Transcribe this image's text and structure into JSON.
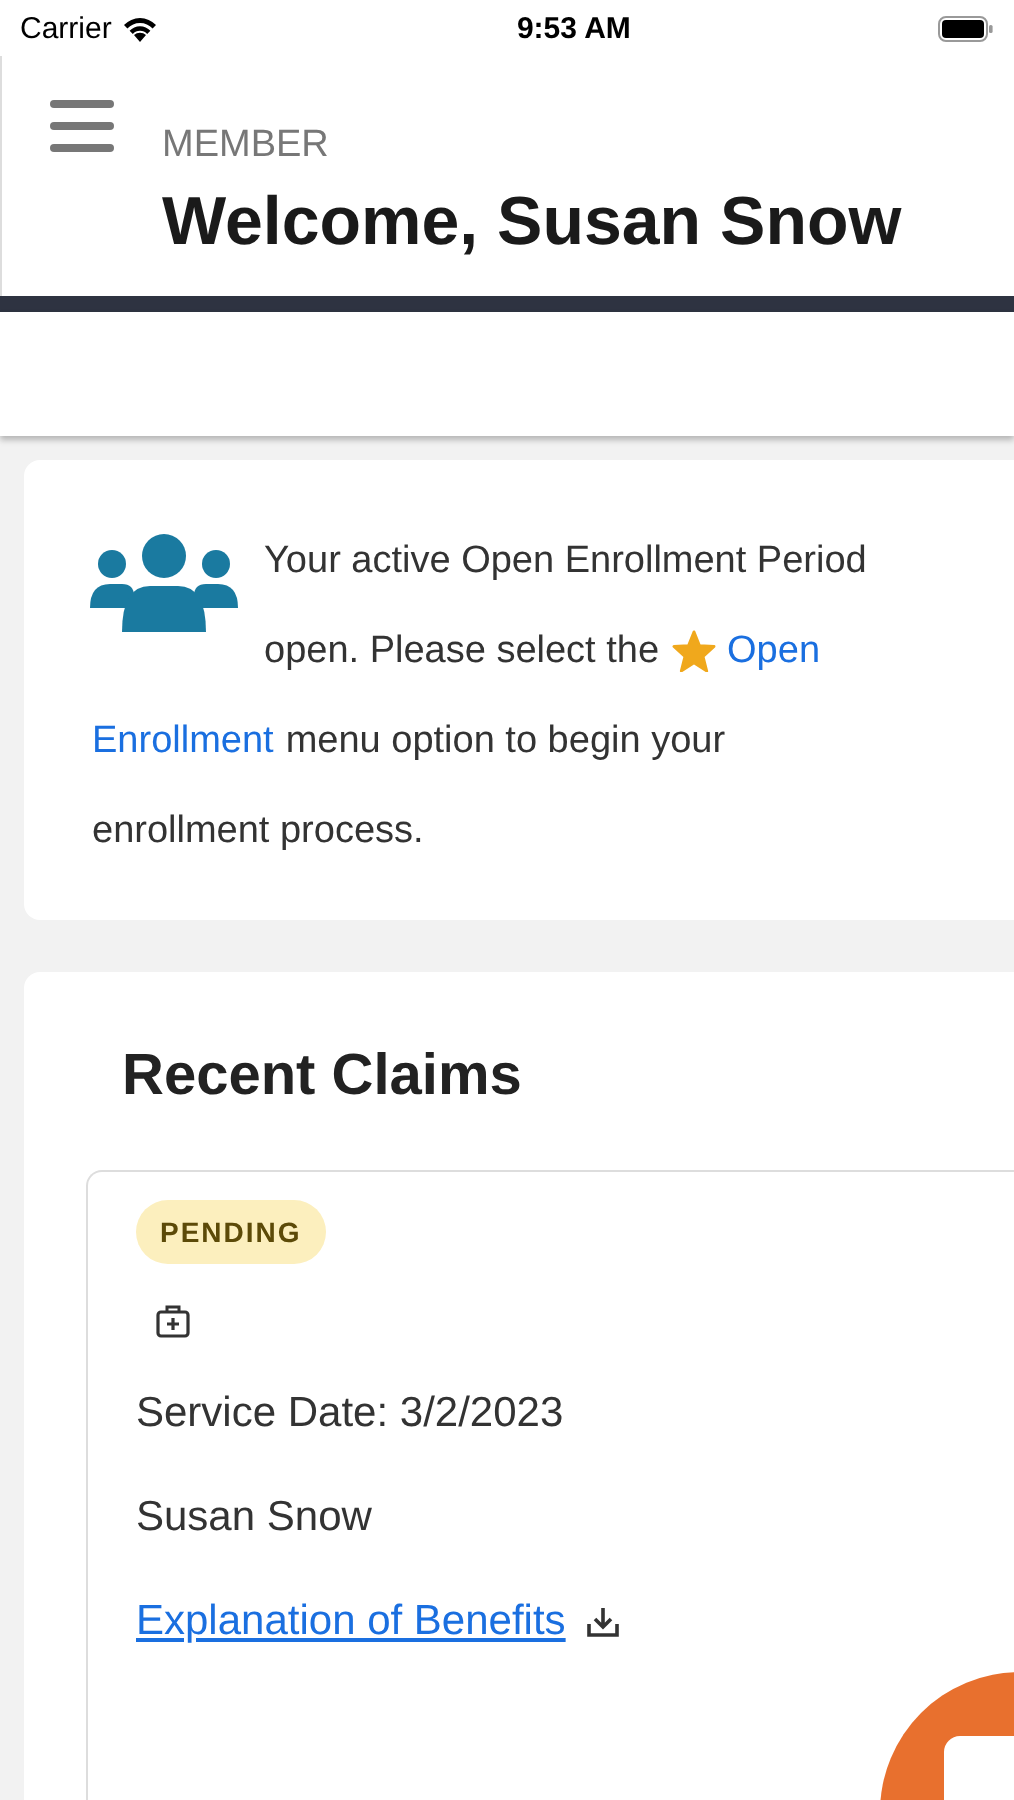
{
  "status_bar": {
    "carrier": "Carrier",
    "time": "9:53 AM"
  },
  "header": {
    "subtitle": "MEMBER",
    "title": "Welcome, Susan Snow"
  },
  "notice": {
    "line_1": "Your active Open Enrollment Period",
    "before_link": "open. Please select the",
    "link_start": "Open",
    "link_end": "Enrollment",
    "after_link": "menu option to begin your",
    "last_line": "enrollment process."
  },
  "claims": {
    "title": "Recent Claims",
    "items": [
      {
        "status": "PENDING",
        "service_date": "Service Date: 3/2/2023",
        "member": "Susan Snow",
        "link": "Explanation of Benefits"
      }
    ]
  }
}
